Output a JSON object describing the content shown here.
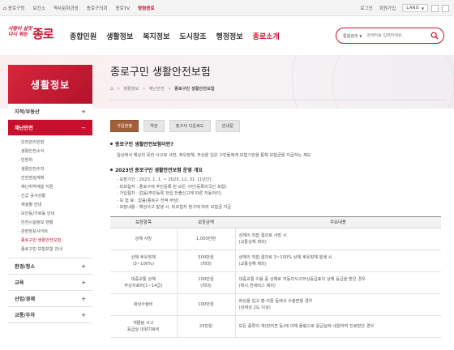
{
  "topbar": {
    "links": [
      {
        "label": "종로구청",
        "icon": "home-icon",
        "active": false
      },
      {
        "label": "보건소",
        "active": false
      },
      {
        "label": "역사문화관광",
        "active": false
      },
      {
        "label": "종로구의회",
        "active": false
      },
      {
        "label": "종로TV",
        "active": false
      },
      {
        "label": "청렴종로",
        "active": true
      }
    ],
    "login": "로그인",
    "join": "회원가입",
    "lang": "LANG"
  },
  "header": {
    "logo_small_line1": "사람이 살맛",
    "logo_small_line2": "다시 뛰는",
    "logo_big": "종로",
    "gnb": [
      {
        "label": "종합민원"
      },
      {
        "label": "생활정보"
      },
      {
        "label": "복지정보"
      },
      {
        "label": "도시창조"
      },
      {
        "label": "행정정보"
      },
      {
        "label": "종로소개"
      }
    ],
    "search_select": "통합검색",
    "search_placeholder": "검색어를 입력하세요."
  },
  "sidebar": {
    "title": "생활정보",
    "items": [
      {
        "label": "지적/부동산",
        "sign": "+"
      },
      {
        "label": "재난안전",
        "sign": "−",
        "active": true
      },
      {
        "label": "환경/청소",
        "sign": "+"
      },
      {
        "label": "교육",
        "sign": "+"
      },
      {
        "label": "산업/경제",
        "sign": "+"
      },
      {
        "label": "교통/주차",
        "sign": "+"
      }
    ],
    "sub_items": [
      "안전관리헌장",
      "생활안전소식",
      "민방위",
      "생활안전수칙",
      "안전점검계획",
      "재난취약계층 지원",
      "긴급 공사상황",
      "재설물 안내",
      "보안등/가로등 안내",
      "안전시설정보 현황",
      "관련정보사이트",
      "종로구민 생활안전보험",
      "종로구민 보험보험 안내"
    ],
    "current_sub": "종로구민 생활안전보험"
  },
  "content": {
    "title": "종로구민 생활안전보험",
    "breadcrumb": [
      "생활정보",
      "재난안전",
      "종로구민 생활안전보험"
    ],
    "tabs": [
      "가입현황",
      "약관",
      "청구서 다운로드",
      "안내문"
    ],
    "section1_title": "종로구민 생활안전보험이란?",
    "section1_text": "일상에서 예상치 못한 사고로 사망, 후유장해, 부상을 입은 구민들에게 보험기관을 통해 보험금을 지급하는 제도",
    "section2_title": "2023년 종로구민 생활안전보험 운영 개요",
    "info": [
      "보장기간 : 2023. 1. 1. ~ 2023. 12. 31. [1년간]",
      "피보험자 : 종로구에 주민등록 된 모든 구민(등록외국인 포함)",
      "가입절차 : 없음(주민등록 전입·전출신고에 따른 자동처리)",
      "보 험 료 : 없음(종로구 전액 부담)",
      "보장내용 : 해당사고 발생 시, 피보험자 청구에 따라 보험금 지급"
    ],
    "table": {
      "headers": [
        "보장항목",
        "보장금액",
        "주요내용"
      ],
      "rows": [
        {
          "item": [
            "상해 사망"
          ],
          "amount": [
            "1,000만원"
          ],
          "desc": [
            "상해의 직접 결과로 사망 시",
            "(교통상해 제외)"
          ]
        },
        {
          "item": [
            "상해 후유장해",
            "(3~100%)"
          ],
          "amount": [
            "500만원",
            "(최대)"
          ],
          "desc": [
            "상해의 직접 결과로 3~100% 상해 후유장해 발생 시",
            "(교통상해 제외)"
          ]
        },
        {
          "item": [
            "대중교통 상해",
            "부상치료비(1~14급)"
          ],
          "amount": [
            "100만원",
            "(최대)"
          ],
          "desc": [
            "대중교통 이용 중 상해로 자동차사고부상등급표의 상해 등급을 받은 경우",
            "(택시,전세버스 제외)"
          ]
        },
        {
          "item": [
            "화상수술비"
          ],
          "amount": [
            "100만원"
          ],
          "desc": [
            "화상을 입고 병·의원 등에서 수술받을 경우",
            "(심재성 2도 이상)"
          ]
        },
        {
          "item": [
            "개물림 사고",
            "응급실 내원치료비"
          ],
          "amount": [
            "25만원"
          ],
          "desc": [
            "모든 종류의 개(반려견 등)에 의해 물림으로 응급실에 내원하여 진료받은 경우"
          ]
        }
      ]
    }
  },
  "colors": {
    "brand": "#c8102e",
    "tab_active": "#a0603a"
  }
}
